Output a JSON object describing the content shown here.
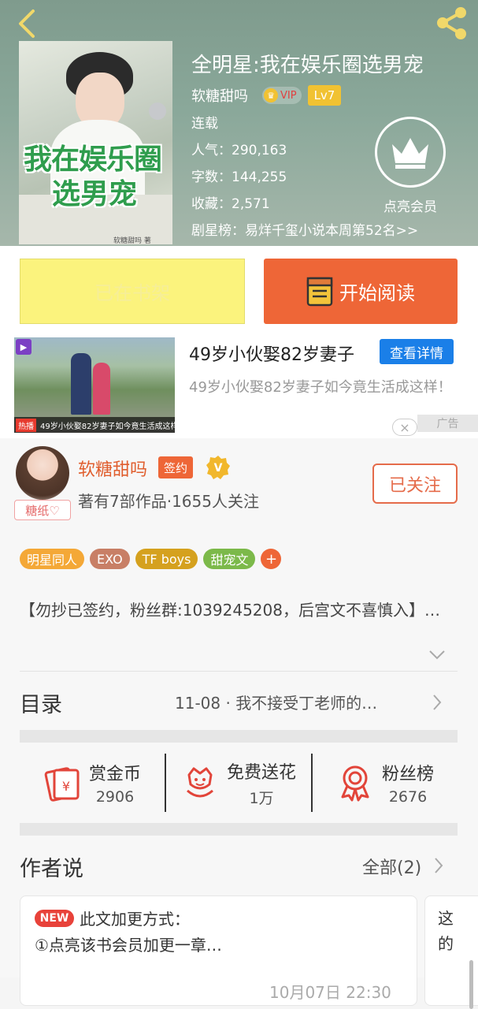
{
  "header": {
    "cover": {
      "title_line1": "我在娱乐圈",
      "title_line2": "选男宠",
      "author_caption": "软糖甜吗 著"
    },
    "book_title": "全明星:我在娱乐圈选男宠",
    "author": "软糖甜吗",
    "vip_label": "VIP",
    "level_label": "Lv7",
    "status": "连载",
    "popularity": "人气：290,163",
    "word_count": "字数：144,255",
    "favorites": "收藏：2,571",
    "ranking": "剧星榜：易烊千玺小说本周第52名>>",
    "member_label": "点亮会员"
  },
  "actions": {
    "shelf_label": "已在书架",
    "read_label": "开始阅读"
  },
  "ad": {
    "thumb_hot": "热播",
    "thumb_caption": "49岁小伙娶82岁妻子如今竟生活成这样!",
    "title": "49岁小伙娶82岁妻子",
    "detail_label": "查看详情",
    "description": "49岁小伙娶82岁妻子如今竟生活成这样！",
    "close_glyph": "×",
    "ad_tag": "广告"
  },
  "author_section": {
    "avatar_tag": "糖纸♡",
    "name": "软糖甜吗",
    "sign_label": "签约",
    "v_badge": "V",
    "stats": "著有7部作品·1655人关注",
    "follow_label": "已关注",
    "tags": [
      {
        "label": "明星同人",
        "color": "#f4a837"
      },
      {
        "label": "EXO",
        "color": "#c87f66"
      },
      {
        "label": "TF boys",
        "color": "#d5a11e"
      },
      {
        "label": "甜宠文",
        "color": "#7cb94a"
      }
    ],
    "tag_add": "+",
    "intro": "【勿抄已签约，粉丝群:1039245208，后宫文不喜慎入】…"
  },
  "toc": {
    "label": "目录",
    "latest": "11-08 · 我不接受丁老师的…"
  },
  "stats": [
    {
      "label": "赏金币",
      "value": "2906",
      "icon": "red-envelope-icon"
    },
    {
      "label": "免费送花",
      "value": "1万",
      "icon": "flower-icon"
    },
    {
      "label": "粉丝榜",
      "value": "2676",
      "icon": "award-ribbon-icon"
    }
  ],
  "author_says": {
    "title": "作者说",
    "all_label": "全部(2)",
    "notes": [
      {
        "new_label": "NEW",
        "title": "此文加更方式：",
        "line": "①点亮该书会员加更一章…",
        "time": "10月07日  22:30"
      },
      {
        "text": "这的"
      }
    ]
  },
  "colors": {
    "accent_orange": "#ee6637",
    "shelf_yellow": "#fbf37d",
    "ad_blue": "#1a7fe8"
  }
}
